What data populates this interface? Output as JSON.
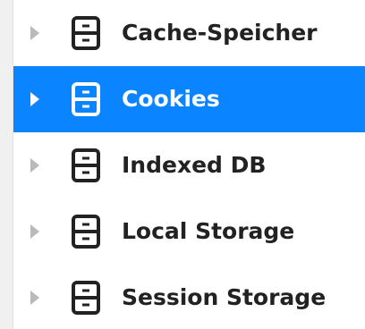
{
  "storage_tree": {
    "items": [
      {
        "label": "Cache-Speicher",
        "icon": "storage-icon",
        "selected": false
      },
      {
        "label": "Cookies",
        "icon": "storage-icon",
        "selected": true
      },
      {
        "label": "Indexed DB",
        "icon": "storage-icon",
        "selected": false
      },
      {
        "label": "Local Storage",
        "icon": "storage-icon",
        "selected": false
      },
      {
        "label": "Session Storage",
        "icon": "storage-icon",
        "selected": false
      }
    ]
  },
  "colors": {
    "selection": "#0a84ff",
    "text": "#222222",
    "selected_text": "#ffffff",
    "twisty": "#b9b9b9"
  }
}
